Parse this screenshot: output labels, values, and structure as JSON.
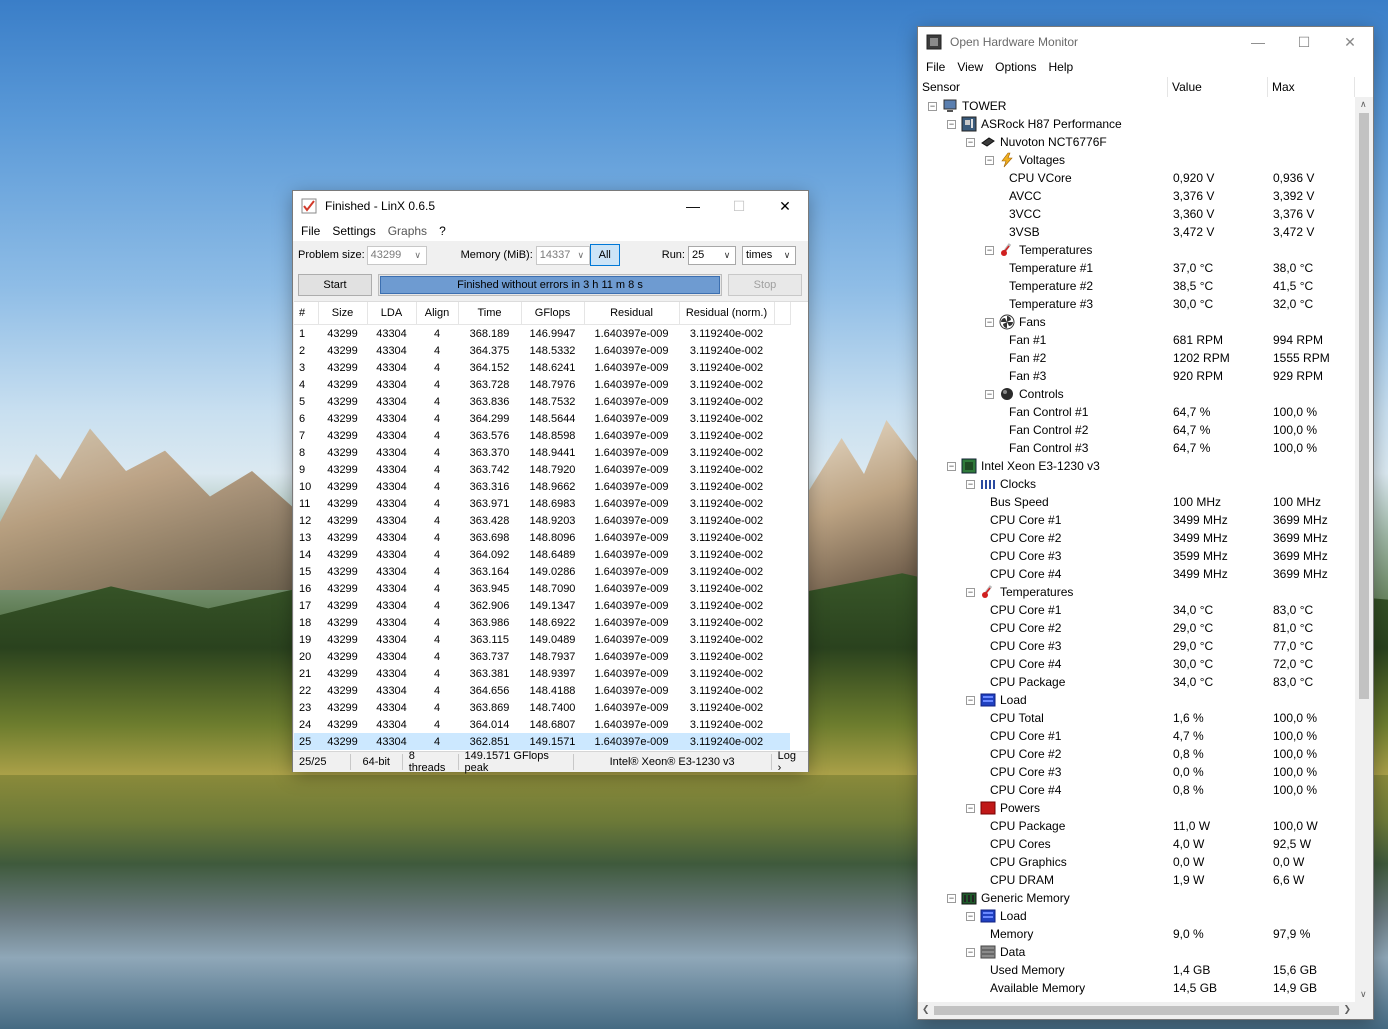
{
  "linx": {
    "title": "Finished - LinX 0.6.5",
    "menu": [
      "File",
      "Settings",
      "Graphs",
      "?"
    ],
    "problem_size_label": "Problem size:",
    "problem_size_value": "43299",
    "memory_label": "Memory (MiB):",
    "memory_value": "14337",
    "all_label": "All",
    "run_label": "Run:",
    "run_value": "25",
    "times_value": "times",
    "start_label": "Start",
    "progress_text": "Finished without errors in 3 h 11 m 8 s",
    "progress_fraction": 1.0,
    "stop_label": "Stop",
    "columns": [
      "#",
      "Size",
      "LDA",
      "Align",
      "Time",
      "GFlops",
      "Residual",
      "Residual (norm.)"
    ],
    "rows": [
      [
        "1",
        "43299",
        "43304",
        "4",
        "368.189",
        "146.9947",
        "1.640397e-009",
        "3.119240e-002"
      ],
      [
        "2",
        "43299",
        "43304",
        "4",
        "364.375",
        "148.5332",
        "1.640397e-009",
        "3.119240e-002"
      ],
      [
        "3",
        "43299",
        "43304",
        "4",
        "364.152",
        "148.6241",
        "1.640397e-009",
        "3.119240e-002"
      ],
      [
        "4",
        "43299",
        "43304",
        "4",
        "363.728",
        "148.7976",
        "1.640397e-009",
        "3.119240e-002"
      ],
      [
        "5",
        "43299",
        "43304",
        "4",
        "363.836",
        "148.7532",
        "1.640397e-009",
        "3.119240e-002"
      ],
      [
        "6",
        "43299",
        "43304",
        "4",
        "364.299",
        "148.5644",
        "1.640397e-009",
        "3.119240e-002"
      ],
      [
        "7",
        "43299",
        "43304",
        "4",
        "363.576",
        "148.8598",
        "1.640397e-009",
        "3.119240e-002"
      ],
      [
        "8",
        "43299",
        "43304",
        "4",
        "363.370",
        "148.9441",
        "1.640397e-009",
        "3.119240e-002"
      ],
      [
        "9",
        "43299",
        "43304",
        "4",
        "363.742",
        "148.7920",
        "1.640397e-009",
        "3.119240e-002"
      ],
      [
        "10",
        "43299",
        "43304",
        "4",
        "363.316",
        "148.9662",
        "1.640397e-009",
        "3.119240e-002"
      ],
      [
        "11",
        "43299",
        "43304",
        "4",
        "363.971",
        "148.6983",
        "1.640397e-009",
        "3.119240e-002"
      ],
      [
        "12",
        "43299",
        "43304",
        "4",
        "363.428",
        "148.9203",
        "1.640397e-009",
        "3.119240e-002"
      ],
      [
        "13",
        "43299",
        "43304",
        "4",
        "363.698",
        "148.8096",
        "1.640397e-009",
        "3.119240e-002"
      ],
      [
        "14",
        "43299",
        "43304",
        "4",
        "364.092",
        "148.6489",
        "1.640397e-009",
        "3.119240e-002"
      ],
      [
        "15",
        "43299",
        "43304",
        "4",
        "363.164",
        "149.0286",
        "1.640397e-009",
        "3.119240e-002"
      ],
      [
        "16",
        "43299",
        "43304",
        "4",
        "363.945",
        "148.7090",
        "1.640397e-009",
        "3.119240e-002"
      ],
      [
        "17",
        "43299",
        "43304",
        "4",
        "362.906",
        "149.1347",
        "1.640397e-009",
        "3.119240e-002"
      ],
      [
        "18",
        "43299",
        "43304",
        "4",
        "363.986",
        "148.6922",
        "1.640397e-009",
        "3.119240e-002"
      ],
      [
        "19",
        "43299",
        "43304",
        "4",
        "363.115",
        "149.0489",
        "1.640397e-009",
        "3.119240e-002"
      ],
      [
        "20",
        "43299",
        "43304",
        "4",
        "363.737",
        "148.7937",
        "1.640397e-009",
        "3.119240e-002"
      ],
      [
        "21",
        "43299",
        "43304",
        "4",
        "363.381",
        "148.9397",
        "1.640397e-009",
        "3.119240e-002"
      ],
      [
        "22",
        "43299",
        "43304",
        "4",
        "364.656",
        "148.4188",
        "1.640397e-009",
        "3.119240e-002"
      ],
      [
        "23",
        "43299",
        "43304",
        "4",
        "363.869",
        "148.7400",
        "1.640397e-009",
        "3.119240e-002"
      ],
      [
        "24",
        "43299",
        "43304",
        "4",
        "364.014",
        "148.6807",
        "1.640397e-009",
        "3.119240e-002"
      ],
      [
        "25",
        "43299",
        "43304",
        "4",
        "362.851",
        "149.1571",
        "1.640397e-009",
        "3.119240e-002"
      ]
    ],
    "selected_row": "25",
    "status": {
      "progress": "25/25",
      "bits": "64-bit",
      "threads": "8 threads",
      "peak": "149.1571 GFlops peak",
      "cpu": "Intel® Xeon® E3-1230 v3",
      "log": "Log ›"
    }
  },
  "ohm": {
    "title": "Open Hardware Monitor",
    "menu": [
      "File",
      "View",
      "Options",
      "Help"
    ],
    "columns": [
      "Sensor",
      "Value",
      "Max"
    ],
    "tree": [
      {
        "level": 0,
        "expander": "minus",
        "icon": "computer-icon",
        "name": "TOWER",
        "value": "",
        "max": ""
      },
      {
        "level": 1,
        "expander": "minus",
        "icon": "motherboard-icon",
        "name": "ASRock H87 Performance",
        "value": "",
        "max": ""
      },
      {
        "level": 2,
        "expander": "minus",
        "icon": "chip-icon",
        "name": "Nuvoton NCT6776F",
        "value": "",
        "max": ""
      },
      {
        "level": 3,
        "expander": "minus",
        "icon": "voltage-icon",
        "name": "Voltages",
        "value": "",
        "max": ""
      },
      {
        "level": 4,
        "expander": "",
        "icon": "",
        "name": "CPU VCore",
        "value": "0,920 V",
        "max": "0,936 V"
      },
      {
        "level": 4,
        "expander": "",
        "icon": "",
        "name": "AVCC",
        "value": "3,376 V",
        "max": "3,392 V"
      },
      {
        "level": 4,
        "expander": "",
        "icon": "",
        "name": "3VCC",
        "value": "3,360 V",
        "max": "3,376 V"
      },
      {
        "level": 4,
        "expander": "",
        "icon": "",
        "name": "3VSB",
        "value": "3,472 V",
        "max": "3,472 V"
      },
      {
        "level": 3,
        "expander": "minus",
        "icon": "thermometer-icon",
        "name": "Temperatures",
        "value": "",
        "max": ""
      },
      {
        "level": 4,
        "expander": "",
        "icon": "",
        "name": "Temperature #1",
        "value": "37,0 °C",
        "max": "38,0 °C"
      },
      {
        "level": 4,
        "expander": "",
        "icon": "",
        "name": "Temperature #2",
        "value": "38,5 °C",
        "max": "41,5 °C"
      },
      {
        "level": 4,
        "expander": "",
        "icon": "",
        "name": "Temperature #3",
        "value": "30,0 °C",
        "max": "32,0 °C"
      },
      {
        "level": 3,
        "expander": "minus",
        "icon": "fan-icon",
        "name": "Fans",
        "value": "",
        "max": ""
      },
      {
        "level": 4,
        "expander": "",
        "icon": "",
        "name": "Fan #1",
        "value": "681 RPM",
        "max": "994 RPM"
      },
      {
        "level": 4,
        "expander": "",
        "icon": "",
        "name": "Fan #2",
        "value": "1202 RPM",
        "max": "1555 RPM"
      },
      {
        "level": 4,
        "expander": "",
        "icon": "",
        "name": "Fan #3",
        "value": "920 RPM",
        "max": "929 RPM"
      },
      {
        "level": 3,
        "expander": "minus",
        "icon": "control-knob-icon",
        "name": "Controls",
        "value": "",
        "max": ""
      },
      {
        "level": 4,
        "expander": "",
        "icon": "",
        "name": "Fan Control #1",
        "value": "64,7 %",
        "max": "100,0 %"
      },
      {
        "level": 4,
        "expander": "",
        "icon": "",
        "name": "Fan Control #2",
        "value": "64,7 %",
        "max": "100,0 %"
      },
      {
        "level": 4,
        "expander": "",
        "icon": "",
        "name": "Fan Control #3",
        "value": "64,7 %",
        "max": "100,0 %"
      },
      {
        "level": 1,
        "expander": "minus",
        "icon": "cpu-icon",
        "name": "Intel Xeon E3-1230 v3",
        "value": "",
        "max": ""
      },
      {
        "level": 2,
        "expander": "minus",
        "icon": "clock-icon",
        "name": "Clocks",
        "value": "",
        "max": ""
      },
      {
        "level": 3,
        "expander": "",
        "icon": "",
        "name": "Bus Speed",
        "value": "100 MHz",
        "max": "100 MHz"
      },
      {
        "level": 3,
        "expander": "",
        "icon": "",
        "name": "CPU Core #1",
        "value": "3499 MHz",
        "max": "3699 MHz"
      },
      {
        "level": 3,
        "expander": "",
        "icon": "",
        "name": "CPU Core #2",
        "value": "3499 MHz",
        "max": "3699 MHz"
      },
      {
        "level": 3,
        "expander": "",
        "icon": "",
        "name": "CPU Core #3",
        "value": "3599 MHz",
        "max": "3699 MHz"
      },
      {
        "level": 3,
        "expander": "",
        "icon": "",
        "name": "CPU Core #4",
        "value": "3499 MHz",
        "max": "3699 MHz"
      },
      {
        "level": 2,
        "expander": "minus",
        "icon": "thermometer-icon",
        "name": "Temperatures",
        "value": "",
        "max": ""
      },
      {
        "level": 3,
        "expander": "",
        "icon": "",
        "name": "CPU Core #1",
        "value": "34,0 °C",
        "max": "83,0 °C"
      },
      {
        "level": 3,
        "expander": "",
        "icon": "",
        "name": "CPU Core #2",
        "value": "29,0 °C",
        "max": "81,0 °C"
      },
      {
        "level": 3,
        "expander": "",
        "icon": "",
        "name": "CPU Core #3",
        "value": "29,0 °C",
        "max": "77,0 °C"
      },
      {
        "level": 3,
        "expander": "",
        "icon": "",
        "name": "CPU Core #4",
        "value": "30,0 °C",
        "max": "72,0 °C"
      },
      {
        "level": 3,
        "expander": "",
        "icon": "",
        "name": "CPU Package",
        "value": "34,0 °C",
        "max": "83,0 °C"
      },
      {
        "level": 2,
        "expander": "minus",
        "icon": "load-icon",
        "name": "Load",
        "value": "",
        "max": ""
      },
      {
        "level": 3,
        "expander": "",
        "icon": "",
        "name": "CPU Total",
        "value": "1,6 %",
        "max": "100,0 %"
      },
      {
        "level": 3,
        "expander": "",
        "icon": "",
        "name": "CPU Core #1",
        "value": "4,7 %",
        "max": "100,0 %"
      },
      {
        "level": 3,
        "expander": "",
        "icon": "",
        "name": "CPU Core #2",
        "value": "0,8 %",
        "max": "100,0 %"
      },
      {
        "level": 3,
        "expander": "",
        "icon": "",
        "name": "CPU Core #3",
        "value": "0,0 %",
        "max": "100,0 %"
      },
      {
        "level": 3,
        "expander": "",
        "icon": "",
        "name": "CPU Core #4",
        "value": "0,8 %",
        "max": "100,0 %"
      },
      {
        "level": 2,
        "expander": "minus",
        "icon": "power-icon",
        "name": "Powers",
        "value": "",
        "max": ""
      },
      {
        "level": 3,
        "expander": "",
        "icon": "",
        "name": "CPU Package",
        "value": "11,0 W",
        "max": "100,0 W"
      },
      {
        "level": 3,
        "expander": "",
        "icon": "",
        "name": "CPU Cores",
        "value": "4,0 W",
        "max": "92,5 W"
      },
      {
        "level": 3,
        "expander": "",
        "icon": "",
        "name": "CPU Graphics",
        "value": "0,0 W",
        "max": "0,0 W"
      },
      {
        "level": 3,
        "expander": "",
        "icon": "",
        "name": "CPU DRAM",
        "value": "1,9 W",
        "max": "6,6 W"
      },
      {
        "level": 1,
        "expander": "minus",
        "icon": "ram-icon",
        "name": "Generic Memory",
        "value": "",
        "max": ""
      },
      {
        "level": 2,
        "expander": "minus",
        "icon": "load-icon",
        "name": "Load",
        "value": "",
        "max": ""
      },
      {
        "level": 3,
        "expander": "",
        "icon": "",
        "name": "Memory",
        "value": "9,0 %",
        "max": "97,9 %"
      },
      {
        "level": 2,
        "expander": "minus",
        "icon": "data-icon",
        "name": "Data",
        "value": "",
        "max": ""
      },
      {
        "level": 3,
        "expander": "",
        "icon": "",
        "name": "Used Memory",
        "value": "1,4 GB",
        "max": "15,6 GB"
      },
      {
        "level": 3,
        "expander": "",
        "icon": "",
        "name": "Available Memory",
        "value": "14,5 GB",
        "max": "14,9 GB"
      }
    ]
  }
}
